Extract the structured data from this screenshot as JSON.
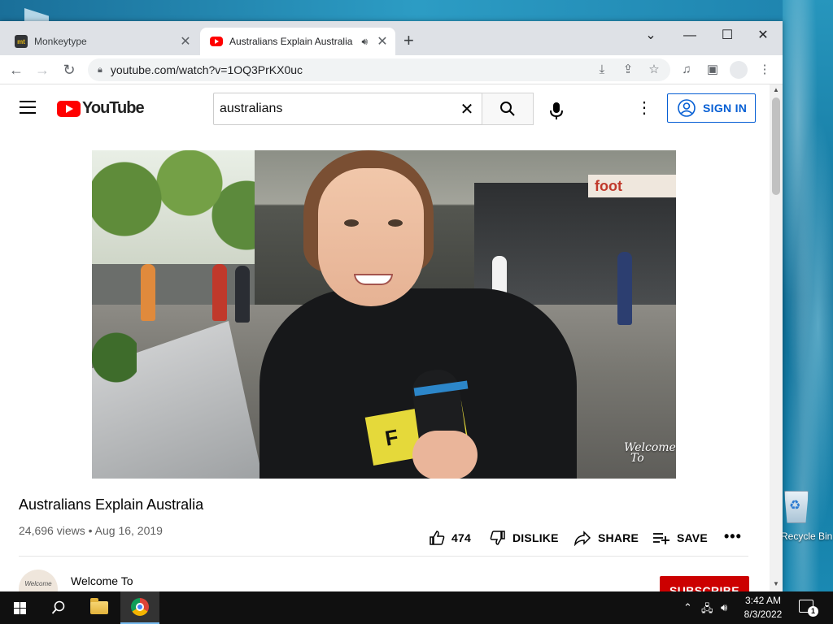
{
  "browser": {
    "tabs": [
      {
        "title": "Monkeytype",
        "favicon": "monkeytype-icon",
        "active": false
      },
      {
        "title": "Australians Explain Australia",
        "favicon": "youtube-icon",
        "active": true,
        "audio": true
      }
    ],
    "address": "youtube.com/watch?v=1OQ3PrKX0uc"
  },
  "youtube": {
    "logo_text": "YouTube",
    "search_value": "australians",
    "sign_in": "SIGN IN",
    "video": {
      "title": "Australians Explain Australia",
      "views": "24,696 views",
      "date": "Aug 16, 2019",
      "likes": "474",
      "dislike": "DISLIKE",
      "share": "SHARE",
      "save": "SAVE",
      "watermark_line1": "Welcome",
      "watermark_line2": "To"
    },
    "channel": {
      "name": "Welcome To",
      "avatar_text": "Welcome",
      "subscribe": "SUBSCRIBE"
    }
  },
  "desktop": {
    "recycle_bin_label": "Recycle Bin"
  },
  "taskbar": {
    "time": "3:42 AM",
    "date": "8/3/2022",
    "notification_count": "1"
  },
  "colors": {
    "youtube_red": "#ff0000",
    "subscribe_red": "#cc0000",
    "link_blue": "#065fd4"
  }
}
